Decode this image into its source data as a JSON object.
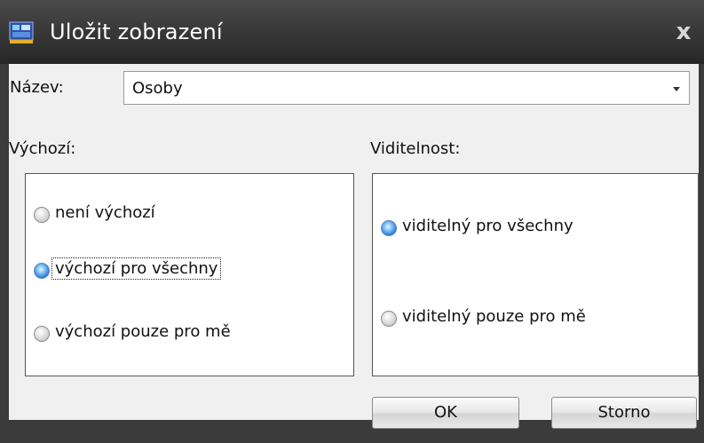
{
  "window": {
    "title": "Uložit zobrazení",
    "icon": "app-window-icon",
    "close_label": "x"
  },
  "name_field": {
    "label": "Název:",
    "value": "Osoby"
  },
  "default_group": {
    "label": "Výchozí:",
    "options": [
      {
        "label": "není výchozí",
        "checked": false
      },
      {
        "label": "výchozí pro všechny",
        "checked": true,
        "focused": true
      },
      {
        "label": "výchozí pouze pro mě",
        "checked": false
      }
    ]
  },
  "visibility_group": {
    "label": "Viditelnost:",
    "options": [
      {
        "label": "viditelný pro všechny",
        "checked": true
      },
      {
        "label": "viditelný pouze pro mě",
        "checked": false
      }
    ]
  },
  "buttons": {
    "ok": "OK",
    "cancel": "Storno"
  },
  "colors": {
    "title_bar": "#333333",
    "radio_checked": "#3f8ee0"
  }
}
